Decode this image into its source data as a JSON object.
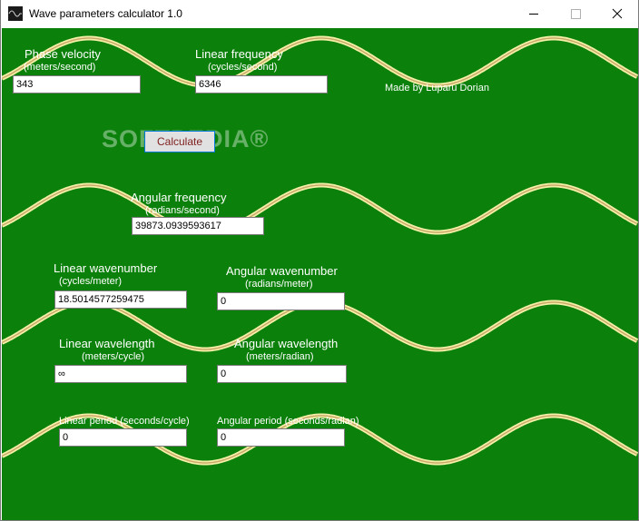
{
  "window": {
    "title": "Wave parameters calculator 1.0",
    "minimize_icon": "minimize-icon",
    "maximize_icon": "maximize-icon",
    "close_icon": "close-icon"
  },
  "colors": {
    "background": "#0b800a",
    "wave": "#f4f0a8",
    "button_text": "#7f1f1f",
    "label": "#ffffff"
  },
  "watermark": "SOFTPEDIA®",
  "credit": "Made by Luparu Dorian",
  "calculate_label": "Calculate",
  "fields": {
    "phase_velocity": {
      "title": "Phase velocity",
      "unit": "(meters/second)",
      "value": "343"
    },
    "linear_frequency": {
      "title": "Linear frequency",
      "unit": "(cycles/second)",
      "value": "6346"
    },
    "angular_frequency": {
      "title": "Angular frequency",
      "unit": "(radians/second)",
      "value": "39873.0939593617"
    },
    "linear_wavenumber": {
      "title": "Linear wavenumber",
      "unit": "(cycles/meter)",
      "value": "18.5014577259475"
    },
    "angular_wavenumber": {
      "title": "Angular wavenumber",
      "unit": "(radians/meter)",
      "value": "0"
    },
    "linear_wavelength": {
      "title": "Linear wavelength",
      "unit": "(meters/cycle)",
      "value": "∞"
    },
    "angular_wavelength": {
      "title": "Angular wavelength",
      "unit": "(meters/radian)",
      "value": "0"
    },
    "linear_period": {
      "title": "Linear period (seconds/cycle)",
      "value": "0"
    },
    "angular_period": {
      "title": "Angular period (seconds/radian)",
      "value": "0"
    }
  }
}
